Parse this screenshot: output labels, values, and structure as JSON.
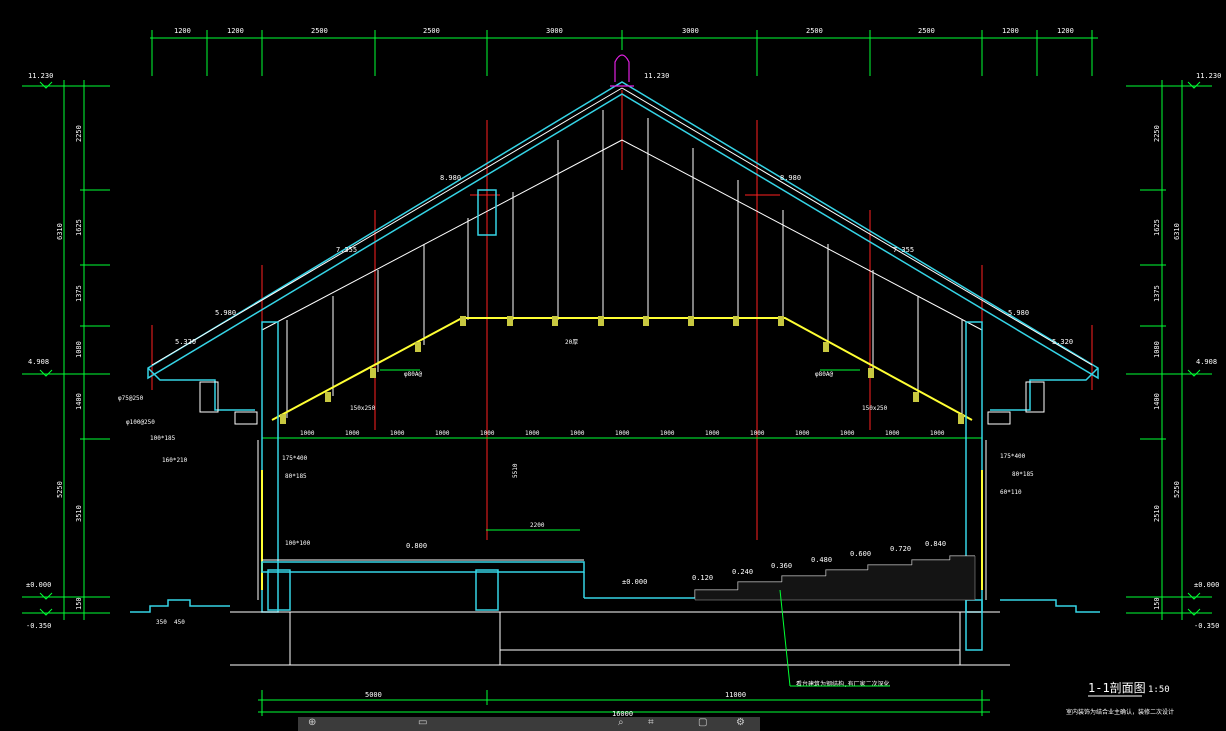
{
  "drawing": {
    "title": "1-1剖面图",
    "scale": "1:50",
    "note": "室内装饰为结合业主确认，装修二次设计",
    "top_dims": [
      "1200",
      "1200",
      "2500",
      "2500",
      "3000",
      "3000",
      "2500",
      "2500",
      "1200",
      "1200"
    ],
    "bottom_dims": [
      "5000",
      "11000"
    ],
    "bottom_total": "16000",
    "left_elev_top": "11.230",
    "right_elev_top": "11.230",
    "ridge_elev": "11.230",
    "left_dims_vert": [
      "2250",
      "6310",
      "1625",
      "1375",
      "1080",
      "1400",
      "5250",
      "3510",
      "150"
    ],
    "right_dims_vert": [
      "2250",
      "6310",
      "1625",
      "1375",
      "1080",
      "1400",
      "5250",
      "2510",
      "150"
    ],
    "elevations_left": [
      "4.908",
      "±0.000",
      "-0.350"
    ],
    "elevations_right": [
      "4.908",
      "±0.000",
      "-0.350"
    ],
    "roof_levels": [
      "8.980",
      "8.980",
      "7.355",
      "7.355",
      "5.980",
      "5.980",
      "5.320",
      "5.320"
    ],
    "ceiling_dims": [
      "1000",
      "1000",
      "1000",
      "1000",
      "1000",
      "1000",
      "1000",
      "1000",
      "1000",
      "1000",
      "1000",
      "1000",
      "1000",
      "1000",
      "1000",
      "1000"
    ],
    "floor_levels": [
      "0.800",
      "±0.000",
      "0.120",
      "0.240",
      "0.360",
      "0.480",
      "0.600",
      "0.720",
      "0.840"
    ],
    "callouts": {
      "left_1": "φ75@250",
      "left_2": "φ100@250",
      "left_3": "100*185",
      "left_4": "160*210",
      "beam": "150x250",
      "beam_r": "150x250",
      "rafter": "φ80A@",
      "rafter_r": "φ80A@",
      "ridge_beam": "20厚",
      "col_1": "175*400",
      "col_2": "80*185",
      "col_3": "60*110",
      "col_4": "100*100",
      "stage_w": "2200",
      "span_5510": "5510",
      "left_450": "450",
      "dims_small": [
        "350",
        "450"
      ],
      "right_col_1": "175*400",
      "right_col_2": "80*185",
      "right_col_3": "60*110",
      "stair_note": "看台建筑为钢结构,有厂家二次深化"
    }
  },
  "taskbar": {
    "items": [
      "⊕",
      "▭",
      "⌕",
      "⌗",
      "▢",
      "⚙"
    ]
  }
}
